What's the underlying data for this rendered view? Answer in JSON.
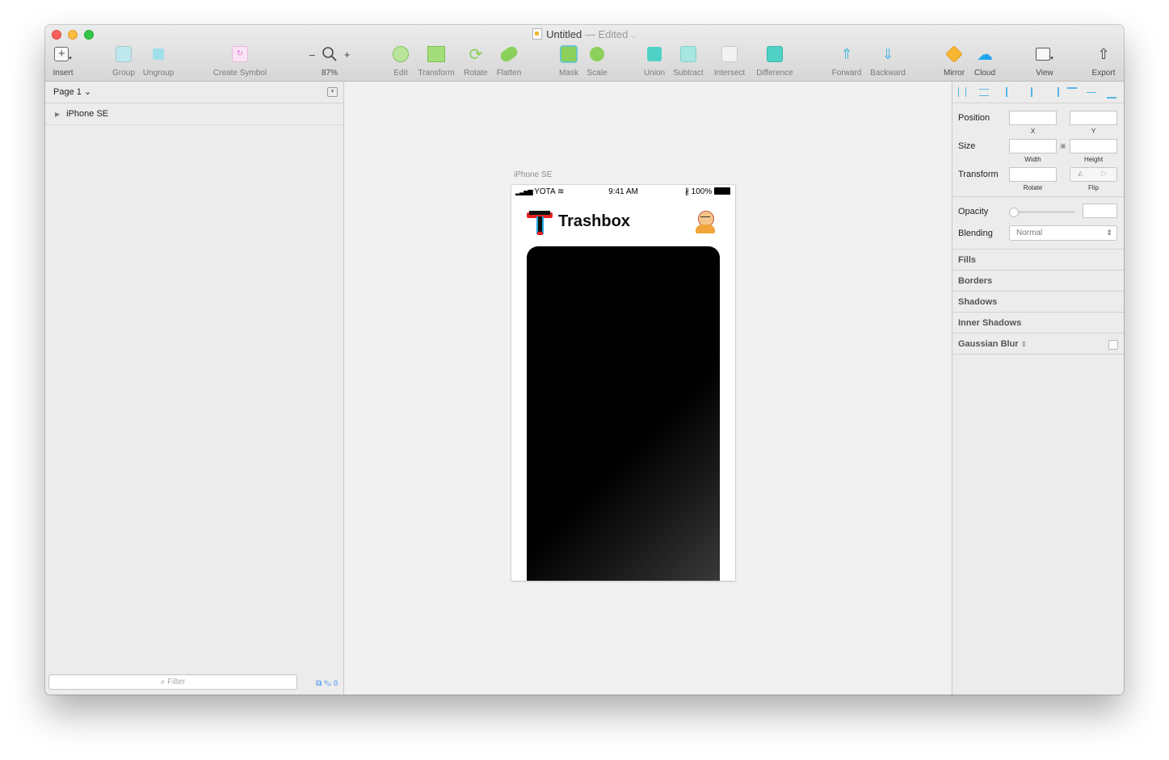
{
  "window": {
    "title": "Untitled",
    "status": "— Edited"
  },
  "toolbar": {
    "insert": "Insert",
    "group": "Group",
    "ungroup": "Ungroup",
    "create_symbol": "Create Symbol",
    "zoom_minus": "–",
    "zoom_plus": "+",
    "zoom_value": "87%",
    "edit": "Edit",
    "transform": "Transform",
    "rotate": "Rotate",
    "flatten": "Flatten",
    "mask": "Mask",
    "scale": "Scale",
    "union": "Union",
    "subtract": "Subtract",
    "intersect": "Intersect",
    "difference": "Difference",
    "forward": "Forward",
    "backward": "Backward",
    "mirror": "Mirror",
    "cloud": "Cloud",
    "view": "View",
    "export": "Export"
  },
  "left_panel": {
    "page_label": "Page 1 ⌄",
    "layers": [
      "iPhone SE"
    ],
    "filter_placeholder": "Filter",
    "filter_count": "0"
  },
  "canvas": {
    "artboard_name": "iPhone SE",
    "status_bar": {
      "carrier": "YOTA",
      "time": "9:41 AM",
      "battery": "100%"
    },
    "app_title": "Trashbox",
    "logo_letter": "T"
  },
  "inspector": {
    "position": "Position",
    "x": "X",
    "y": "Y",
    "size": "Size",
    "width": "Width",
    "height": "Height",
    "transform": "Transform",
    "rotate": "Rotate",
    "flip": "Flip",
    "opacity": "Opacity",
    "blending": "Blending",
    "blending_value": "Normal",
    "sections": [
      "Fills",
      "Borders",
      "Shadows",
      "Inner Shadows",
      "Gaussian Blur"
    ]
  },
  "colors": {
    "accent": "#2d86f2",
    "tool_teal": "#4fd1c5",
    "tool_green": "#8bd05a",
    "symbol_pink": "#e07bd8",
    "logo_red": "#e32222",
    "logo_cyan": "#1fa6e0"
  }
}
